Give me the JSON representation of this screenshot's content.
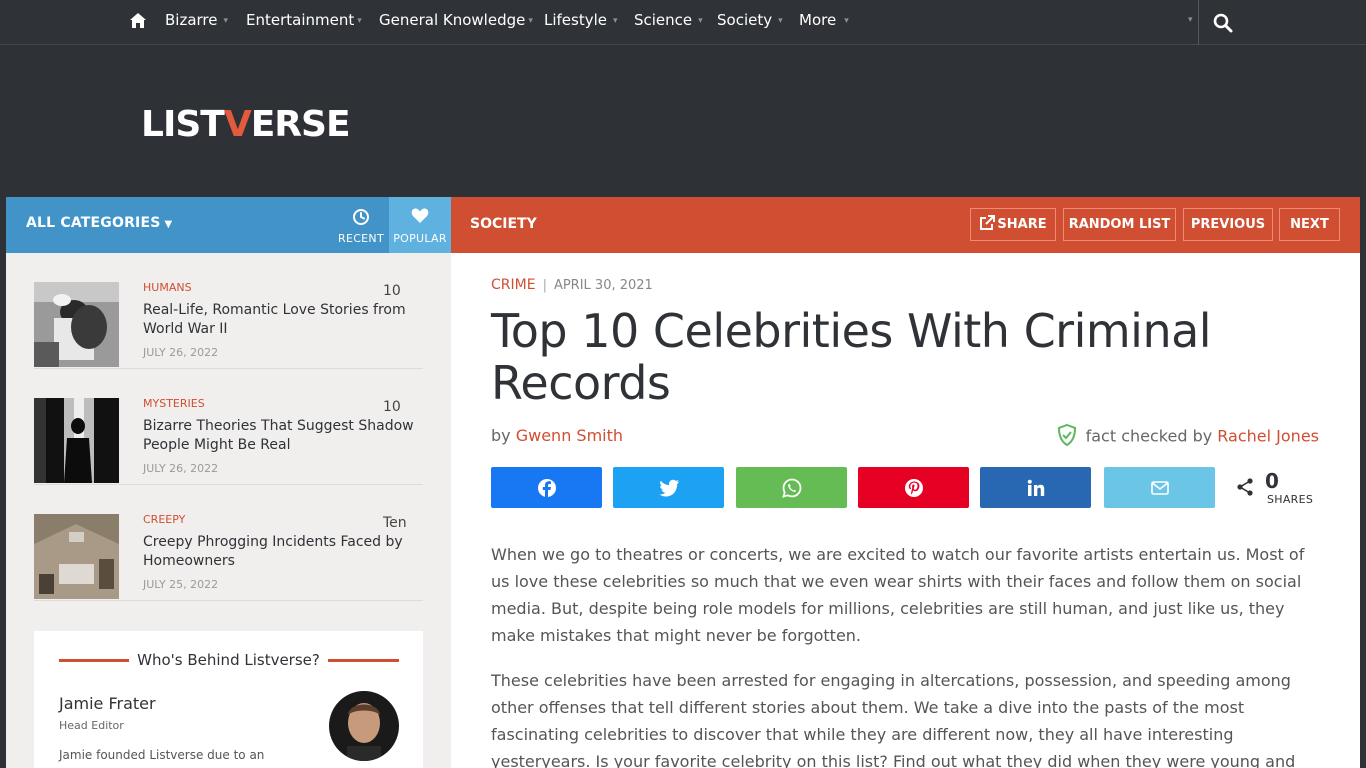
{
  "nav": {
    "items": [
      {
        "label": "Bizarre",
        "caret": "▾"
      },
      {
        "label": "Entertainment",
        "caret": "▾"
      },
      {
        "label": "General Knowledge",
        "caret": "▾"
      },
      {
        "label": "Lifestyle",
        "caret": "▾"
      },
      {
        "label": "Science",
        "caret": "▾"
      },
      {
        "label": "Society",
        "caret": "▾"
      },
      {
        "label": "More",
        "caret": "▾"
      }
    ],
    "right_caret": "▾",
    "icons": [
      "home-icon",
      "search-icon"
    ]
  },
  "logo": {
    "part1": "LIST",
    "v": "V",
    "part2": "ERSE"
  },
  "catbar": {
    "all_categories": "ALL CATEGORIES",
    "tri": "▼",
    "recent": "RECENT",
    "popular": "POPULAR"
  },
  "secbar": {
    "section": "SOCIETY",
    "share": "SHARE",
    "random": "RANDOM LIST",
    "previous": "PREVIOUS",
    "next": "NEXT"
  },
  "sidebar": {
    "items": [
      {
        "category": "HUMANS",
        "count": "10",
        "title": "Real-Life, Romantic Love Stories from World War II",
        "date": "JULY 26, 2022"
      },
      {
        "category": "MYSTERIES",
        "count": "10",
        "title": "Bizarre Theories That Suggest Shadow People Might Be Real",
        "date": "JULY 26, 2022"
      },
      {
        "category": "CREEPY",
        "count": "Ten",
        "title": "Creepy Phrogging Incidents Faced by Homeowners",
        "date": "JULY 25, 2022"
      }
    ],
    "who": {
      "heading": "Who's Behind Listverse?",
      "name": "Jamie Frater",
      "role": "Head Editor",
      "bio": "Jamie founded Listverse due to an"
    }
  },
  "article": {
    "category": "CRIME",
    "separator": "|",
    "date": "APRIL 30, 2021",
    "title": "Top 10 Celebrities With Criminal Records",
    "by": "by",
    "author": "Gwenn Smith",
    "fact_checked_by": "fact checked by",
    "checker": "Rachel Jones",
    "share_count": "0",
    "shares_label": "SHARES",
    "paragraphs": [
      "When we go to theatres or concerts, we are excited to watch our favorite artists entertain us. Most of us love these celebrities so much that we even wear shirts with their faces and follow them on social media.  But, despite being role models for millions, celebrities are still human, and just like us, they make mistakes that might never be forgotten.",
      "These celebrities have been arrested for engaging in altercations, possession, and speeding among other offenses that tell different stories about them. We take a dive into the pasts of the most fascinating celebrities to discover that while they are different now, they all have interesting yesteryears. Is your favorite celebrity on this list? Find out what they did when they were young and wild!"
    ]
  },
  "share_buttons": [
    {
      "network": "facebook-icon",
      "color": "#1877f2"
    },
    {
      "network": "twitter-icon",
      "color": "#1da1f2"
    },
    {
      "network": "whatsapp-icon",
      "color": "#65bc54"
    },
    {
      "network": "pinterest-icon",
      "color": "#e60023"
    },
    {
      "network": "linkedin-icon",
      "color": "#2867b2"
    },
    {
      "network": "email-icon",
      "color": "#6bc5e6"
    }
  ],
  "colors": {
    "nav_bg": "#2f3237",
    "accent_red": "#d04e32",
    "accent_blue": "#4294c8",
    "popular_blue": "#5fb1e0"
  }
}
